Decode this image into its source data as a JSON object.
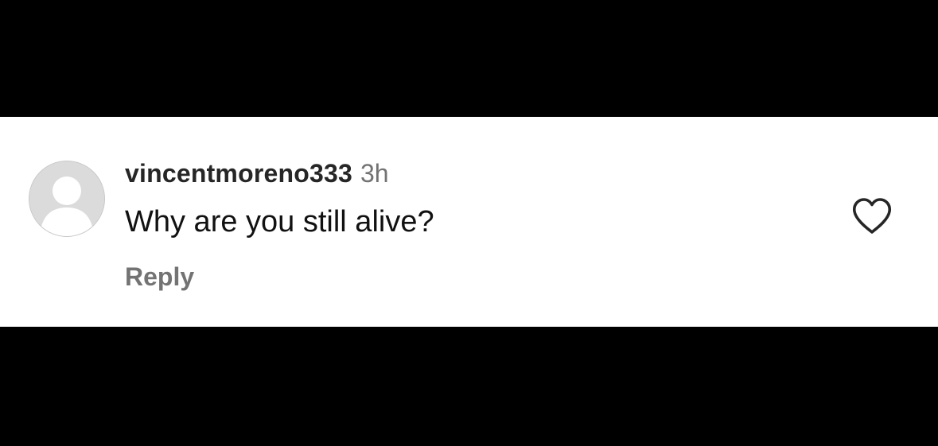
{
  "comment": {
    "username": "vincentmoreno333",
    "timestamp": "3h",
    "text": "Why are you still alive?",
    "reply_label": "Reply",
    "avatar_icon": "default-profile-avatar",
    "like_icon": "heart-outline-icon"
  },
  "colors": {
    "background": "#000000",
    "card": "#ffffff",
    "username": "#262626",
    "secondary_text": "#737373",
    "body_text": "#111111",
    "avatar_fill": "#dbdbdb"
  }
}
